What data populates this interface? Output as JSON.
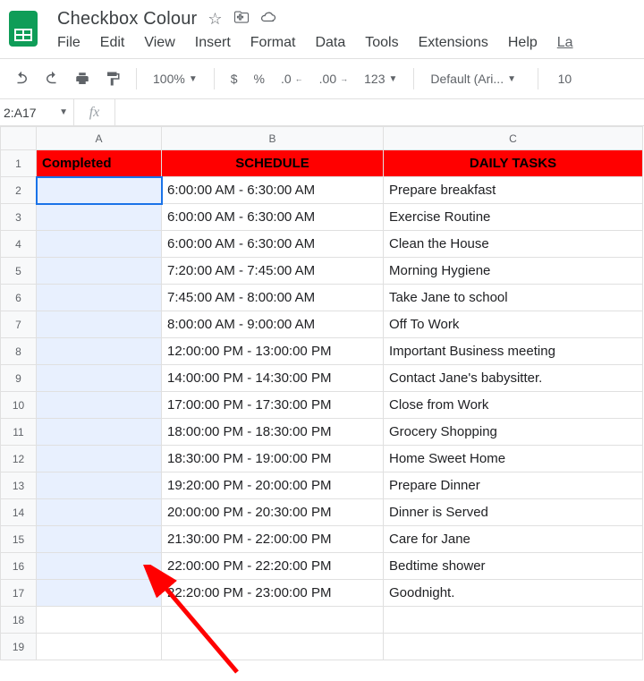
{
  "doc": {
    "title": "Checkbox Colour"
  },
  "menu": {
    "file": "File",
    "edit": "Edit",
    "view": "View",
    "insert": "Insert",
    "format": "Format",
    "data": "Data",
    "tools": "Tools",
    "extensions": "Extensions",
    "help": "Help",
    "more": "La"
  },
  "toolbar": {
    "zoom": "100%",
    "currency": "$",
    "percent": "%",
    "dec_dec": ".0",
    "dec_inc": ".00",
    "numfmt": "123",
    "font": "Default (Ari...",
    "fontsize": "10"
  },
  "formula": {
    "namebox": "2:A17",
    "fx": "fx",
    "value": ""
  },
  "grid": {
    "cols": [
      "A",
      "B",
      "C"
    ],
    "header": [
      "Completed",
      "SCHEDULE",
      "DAILY TASKS"
    ],
    "rows": [
      [
        "",
        "6:00:00 AM - 6:30:00 AM",
        "Prepare breakfast"
      ],
      [
        "",
        "6:00:00 AM - 6:30:00 AM",
        "Exercise Routine"
      ],
      [
        "",
        "6:00:00 AM - 6:30:00 AM",
        "Clean the House"
      ],
      [
        "",
        "7:20:00 AM - 7:45:00 AM",
        "Morning Hygiene"
      ],
      [
        "",
        "7:45:00 AM - 8:00:00 AM",
        "Take Jane to school"
      ],
      [
        "",
        "8:00:00 AM - 9:00:00 AM",
        "Off To Work"
      ],
      [
        "",
        "12:00:00 PM - 13:00:00 PM",
        "Important Business meeting"
      ],
      [
        "",
        "14:00:00 PM - 14:30:00 PM",
        "Contact Jane's babysitter."
      ],
      [
        "",
        "17:00:00 PM - 17:30:00 PM",
        "Close from Work"
      ],
      [
        "",
        "18:00:00 PM - 18:30:00 PM",
        "Grocery Shopping"
      ],
      [
        "",
        "18:30:00 PM - 19:00:00 PM",
        "Home Sweet Home"
      ],
      [
        "",
        "19:20:00 PM - 20:00:00 PM",
        "Prepare Dinner"
      ],
      [
        "",
        "20:00:00 PM - 20:30:00 PM",
        "Dinner is Served"
      ],
      [
        "",
        "21:30:00 PM - 22:00:00 PM",
        "Care for Jane"
      ],
      [
        "",
        "22:00:00 PM - 22:20:00 PM",
        "Bedtime shower"
      ],
      [
        "",
        "22:20:00 PM - 23:00:00 PM",
        "Goodnight."
      ]
    ],
    "blank_rows": [
      18,
      19
    ]
  }
}
